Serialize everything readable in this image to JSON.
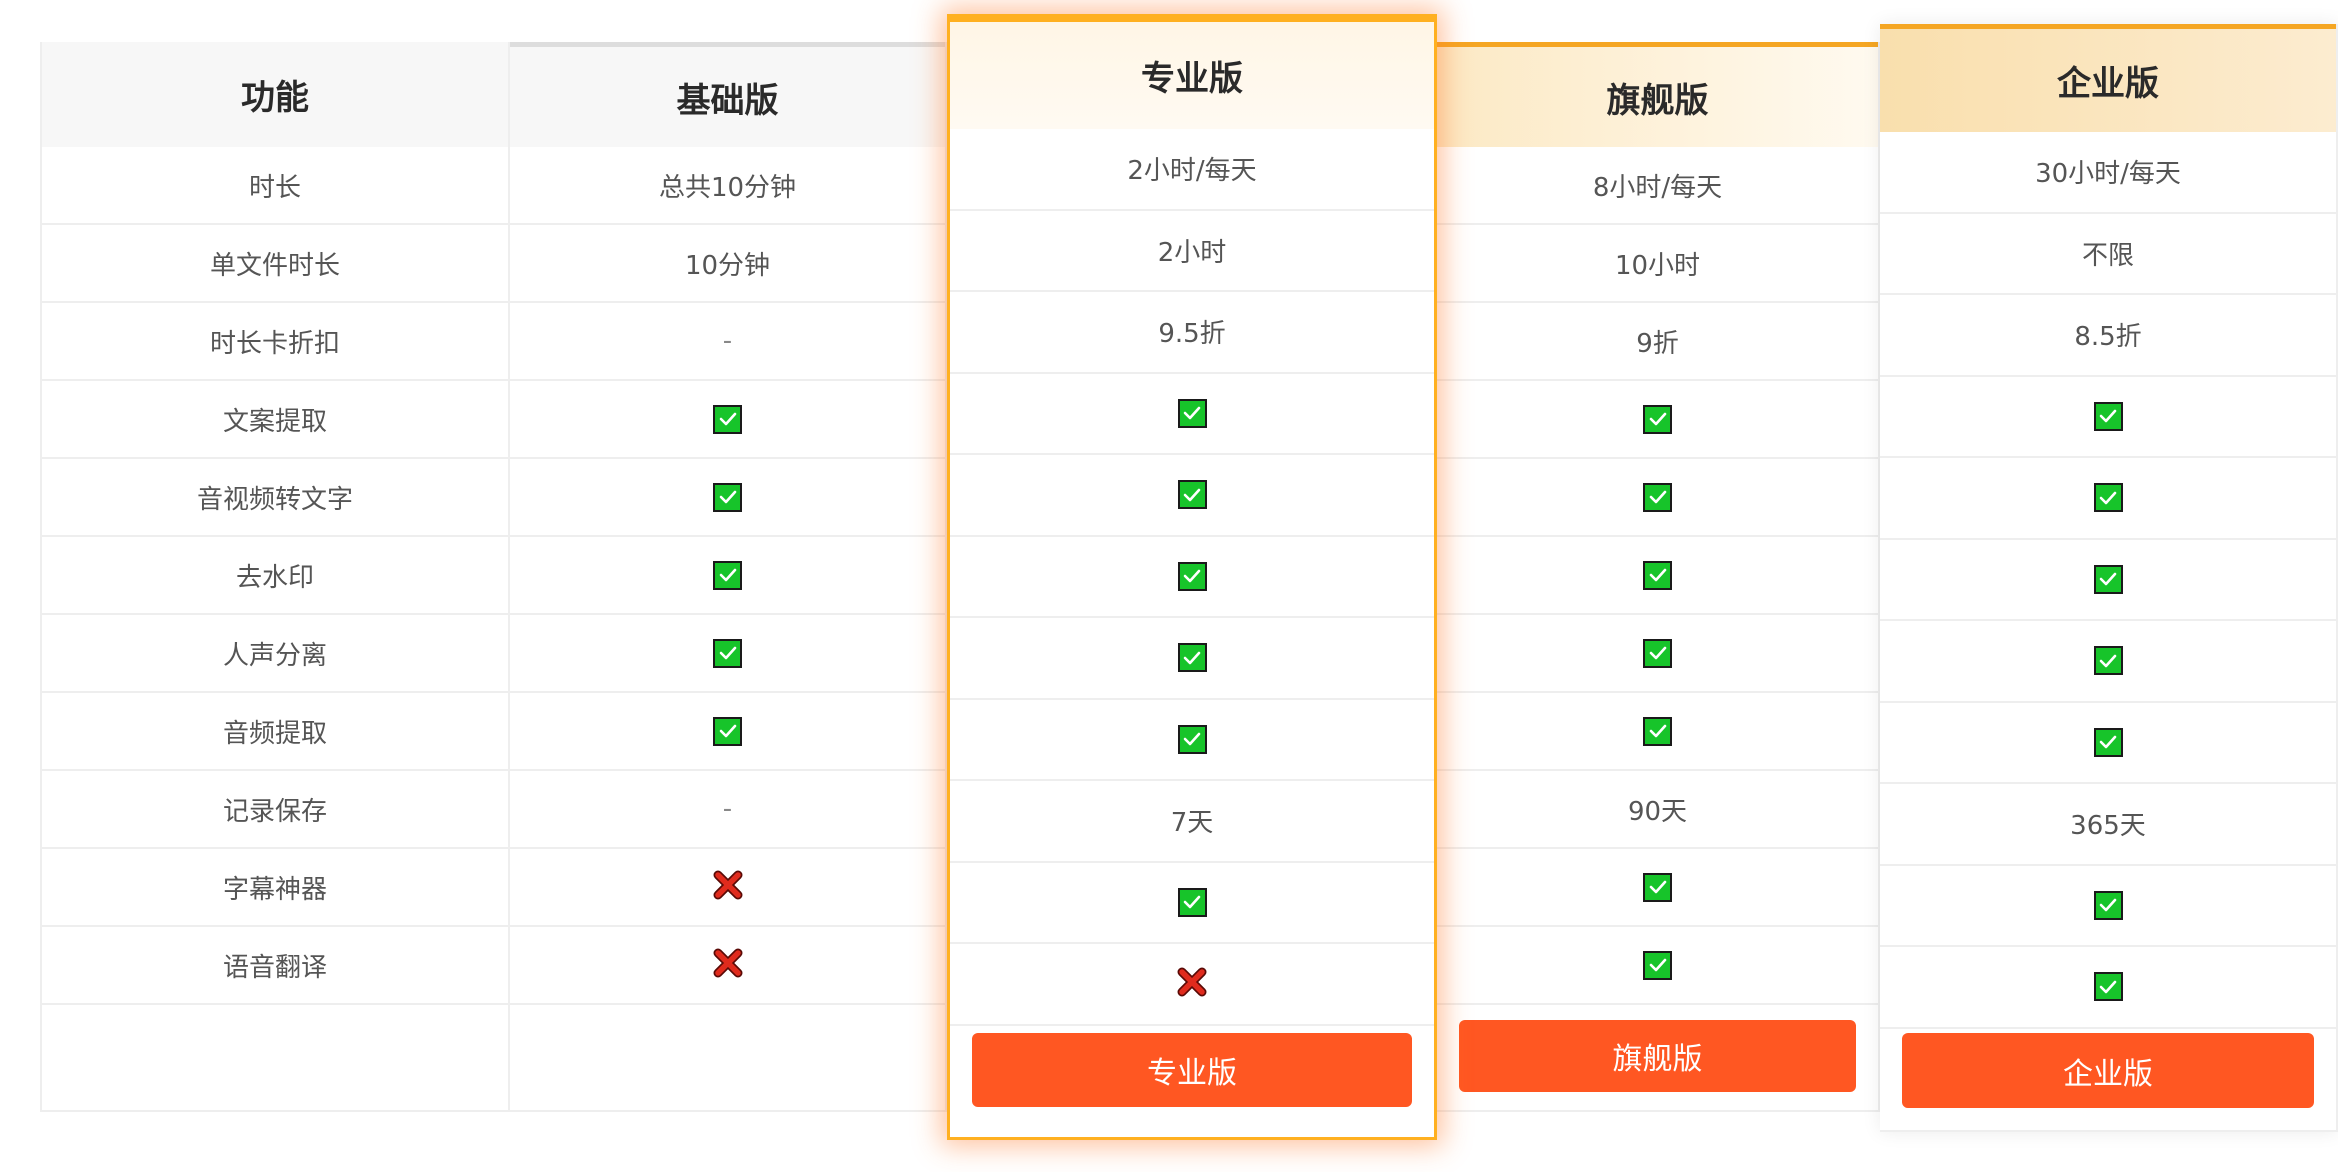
{
  "columns": [
    {
      "id": "feature",
      "header": "功能",
      "cells": [
        {
          "type": "text",
          "value": "时长"
        },
        {
          "type": "text",
          "value": "单文件时长"
        },
        {
          "type": "text",
          "value": "时长卡折扣"
        },
        {
          "type": "text",
          "value": "文案提取"
        },
        {
          "type": "text",
          "value": "音视频转文字"
        },
        {
          "type": "text",
          "value": "去水印"
        },
        {
          "type": "text",
          "value": "人声分离"
        },
        {
          "type": "text",
          "value": "音频提取"
        },
        {
          "type": "text",
          "value": "记录保存"
        },
        {
          "type": "text",
          "value": "字幕神器"
        },
        {
          "type": "text",
          "value": "语音翻译"
        }
      ]
    },
    {
      "id": "basic",
      "header": "基础版",
      "cells": [
        {
          "type": "text",
          "value": "总共10分钟"
        },
        {
          "type": "text",
          "value": "10分钟"
        },
        {
          "type": "text",
          "value": "-"
        },
        {
          "type": "check"
        },
        {
          "type": "check"
        },
        {
          "type": "check"
        },
        {
          "type": "check"
        },
        {
          "type": "check"
        },
        {
          "type": "text",
          "value": "-"
        },
        {
          "type": "cross"
        },
        {
          "type": "cross"
        }
      ]
    },
    {
      "id": "pro",
      "header": "专业版",
      "button": "专业版",
      "cells": [
        {
          "type": "text",
          "value": "2小时/每天"
        },
        {
          "type": "text",
          "value": "2小时"
        },
        {
          "type": "text",
          "value": "9.5折"
        },
        {
          "type": "check"
        },
        {
          "type": "check"
        },
        {
          "type": "check"
        },
        {
          "type": "check"
        },
        {
          "type": "check"
        },
        {
          "type": "text",
          "value": "7天"
        },
        {
          "type": "check"
        },
        {
          "type": "cross"
        }
      ]
    },
    {
      "id": "flagship",
      "header": "旗舰版",
      "button": "旗舰版",
      "cells": [
        {
          "type": "text",
          "value": "8小时/每天"
        },
        {
          "type": "text",
          "value": "10小时"
        },
        {
          "type": "text",
          "value": "9折"
        },
        {
          "type": "check"
        },
        {
          "type": "check"
        },
        {
          "type": "check"
        },
        {
          "type": "check"
        },
        {
          "type": "check"
        },
        {
          "type": "text",
          "value": "90天"
        },
        {
          "type": "check"
        },
        {
          "type": "check"
        }
      ]
    },
    {
      "id": "enterprise",
      "header": "企业版",
      "button": "企业版",
      "cells": [
        {
          "type": "text",
          "value": "30小时/每天"
        },
        {
          "type": "text",
          "value": "不限"
        },
        {
          "type": "text",
          "value": "8.5折"
        },
        {
          "type": "check"
        },
        {
          "type": "check"
        },
        {
          "type": "check"
        },
        {
          "type": "check"
        },
        {
          "type": "check"
        },
        {
          "type": "text",
          "value": "365天"
        },
        {
          "type": "check"
        },
        {
          "type": "check"
        }
      ]
    }
  ],
  "colors": {
    "accent_button": "#ff5722",
    "check_green": "#17c42a",
    "cross_red": "#e02b1d",
    "pro_border": "#ffb020",
    "header_gold": "#fbe2b0"
  }
}
